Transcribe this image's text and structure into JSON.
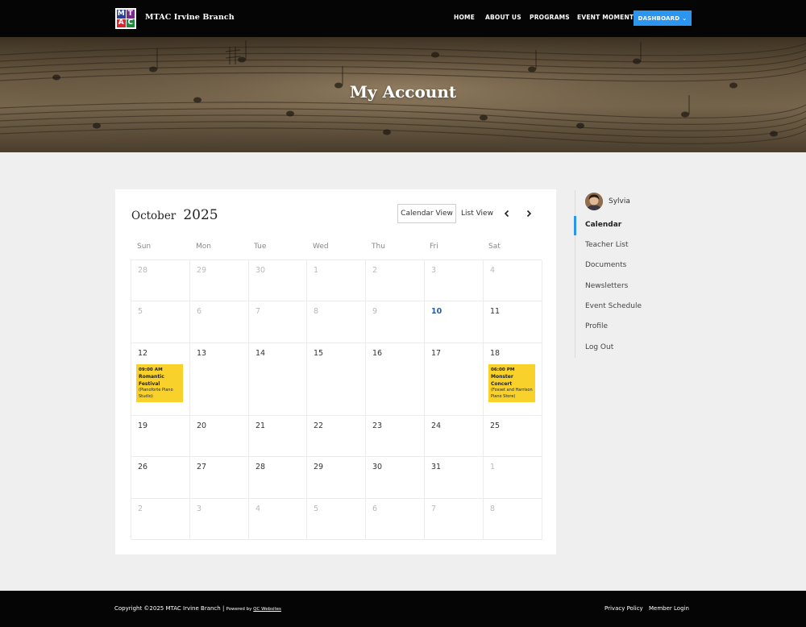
{
  "header": {
    "logo_letters": [
      "M",
      "T",
      "A",
      "C"
    ],
    "brand": "MTAC Irvine Branch",
    "nav": {
      "home": "HOME",
      "about": "ABOUT US",
      "programs": "PROGRAMS",
      "moments": "EVENT MOMENTS"
    },
    "dashboard_label": "DASHBOARD",
    "dashboard_caret": "⌄"
  },
  "hero": {
    "title": "My Account"
  },
  "calendar": {
    "month": "October",
    "year": "2025",
    "calendar_view_label": "Calendar View",
    "list_view_label": "List View",
    "days_of_week": [
      "Sun",
      "Mon",
      "Tue",
      "Wed",
      "Thu",
      "Fri",
      "Sat"
    ],
    "weeks": [
      [
        {
          "d": "28",
          "m": true
        },
        {
          "d": "29",
          "m": true
        },
        {
          "d": "30",
          "m": true
        },
        {
          "d": "1",
          "m": true
        },
        {
          "d": "2",
          "m": true
        },
        {
          "d": "3",
          "m": true
        },
        {
          "d": "4",
          "m": true
        }
      ],
      [
        {
          "d": "5",
          "m": true
        },
        {
          "d": "6",
          "m": true
        },
        {
          "d": "7",
          "m": true
        },
        {
          "d": "8",
          "m": true
        },
        {
          "d": "9",
          "m": true
        },
        {
          "d": "10",
          "today": true
        },
        {
          "d": "11"
        }
      ],
      [
        {
          "d": "12"
        },
        {
          "d": "13"
        },
        {
          "d": "14"
        },
        {
          "d": "15"
        },
        {
          "d": "16"
        },
        {
          "d": "17"
        },
        {
          "d": "18"
        }
      ],
      [
        {
          "d": "19"
        },
        {
          "d": "20"
        },
        {
          "d": "21"
        },
        {
          "d": "22"
        },
        {
          "d": "23"
        },
        {
          "d": "24"
        },
        {
          "d": "25"
        }
      ],
      [
        {
          "d": "26"
        },
        {
          "d": "27"
        },
        {
          "d": "28"
        },
        {
          "d": "29"
        },
        {
          "d": "30"
        },
        {
          "d": "31"
        },
        {
          "d": "1",
          "m": true
        }
      ],
      [
        {
          "d": "2",
          "m": true
        },
        {
          "d": "3",
          "m": true
        },
        {
          "d": "4",
          "m": true
        },
        {
          "d": "5",
          "m": true
        },
        {
          "d": "6",
          "m": true
        },
        {
          "d": "7",
          "m": true
        },
        {
          "d": "8",
          "m": true
        }
      ]
    ],
    "events": [
      {
        "week": 2,
        "day": 0,
        "time": "09:00 AM",
        "name": "Romantic Festival",
        "place": "(Pianoforte Piano Studio)"
      },
      {
        "week": 2,
        "day": 6,
        "time": "06:00 PM",
        "name": "Monster Concert",
        "place": "(Fosset and Harrison Piano Store)"
      }
    ],
    "colors": {
      "event_bg": "#f8d22a",
      "today": "#2a5d9c"
    }
  },
  "sidebar": {
    "user_name": "Sylvia",
    "items": [
      {
        "label": "Calendar",
        "active": true
      },
      {
        "label": "Teacher List"
      },
      {
        "label": "Documents"
      },
      {
        "label": "Newsletters"
      },
      {
        "label": "Event Schedule"
      },
      {
        "label": "Profile"
      },
      {
        "label": "Log Out"
      }
    ],
    "accent": "#2b95f0"
  },
  "footer": {
    "copyright": "Copyright ©2025 MTAC Irvine Branch",
    "separator": " | ",
    "powered_by": "Powered by ",
    "powered_link": "QC Websites",
    "privacy": "Privacy Policy",
    "member_login": "Member Login"
  }
}
